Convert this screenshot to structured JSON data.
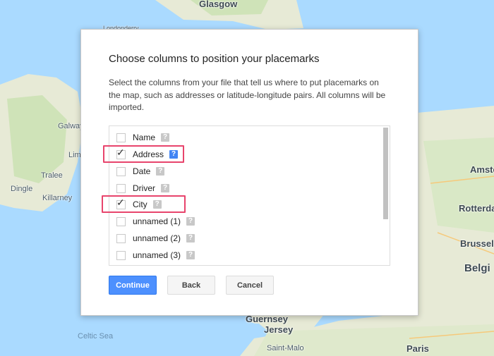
{
  "map": {
    "labels": [
      "Glasgow",
      "Londonderry",
      "Galway",
      "Lim",
      "Tralee",
      "Dingle",
      "Killarney",
      "Celtic Sea",
      "Guernsey",
      "Jersey",
      "Saint-Malo",
      "Amste",
      "Rotterdar",
      "Brussels",
      "Belgi",
      "Paris"
    ],
    "land_color": "#e6e8d4",
    "water_color": "#aadaff"
  },
  "dialog": {
    "title": "Choose columns to position your placemarks",
    "description": "Select the columns from your file that tell us where to put placemarks on the map, such as addresses or latitude-longitude pairs. All columns will be imported.",
    "columns": [
      {
        "label": "Name",
        "checked": false,
        "help_active": false
      },
      {
        "label": "Address",
        "checked": true,
        "help_active": true
      },
      {
        "label": "Date",
        "checked": false,
        "help_active": false
      },
      {
        "label": "Driver",
        "checked": false,
        "help_active": false
      },
      {
        "label": "City",
        "checked": true,
        "help_active": false
      },
      {
        "label": "unnamed (1)",
        "checked": false,
        "help_active": false
      },
      {
        "label": "unnamed (2)",
        "checked": false,
        "help_active": false
      },
      {
        "label": "unnamed (3)",
        "checked": false,
        "help_active": false
      }
    ],
    "help_glyph": "?",
    "check_glyph": "✓",
    "buttons": {
      "continue": "Continue",
      "back": "Back",
      "cancel": "Cancel"
    },
    "accent_color": "#4d90fe",
    "highlight_color": "#e8446c"
  }
}
